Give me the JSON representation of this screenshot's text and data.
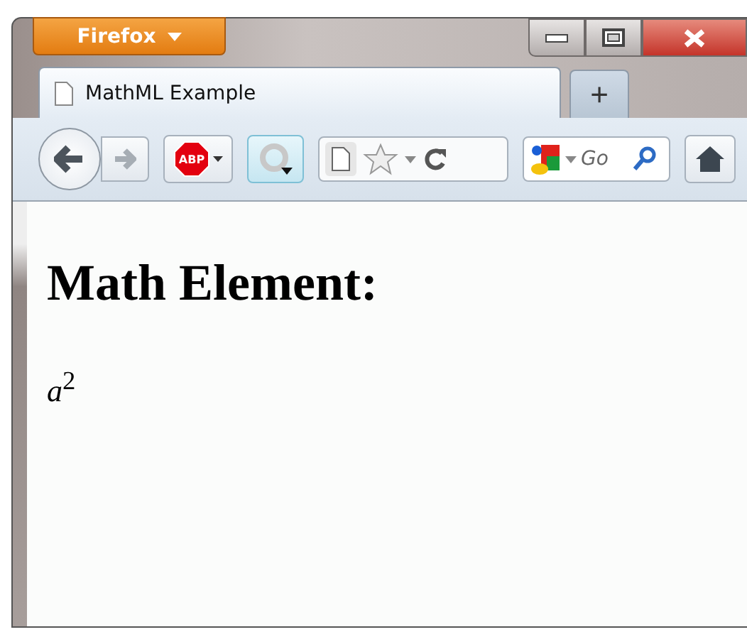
{
  "window": {
    "menu_button": "Firefox"
  },
  "tabs": [
    {
      "label": "MathML Example",
      "selected": true
    }
  ],
  "new_tab": "+",
  "toolbar": {
    "adblock_label": "ABP",
    "search": {
      "placeholder": "Go"
    }
  },
  "page": {
    "heading": "Math Element:",
    "math": "*a*$^{2}$"
  }
}
